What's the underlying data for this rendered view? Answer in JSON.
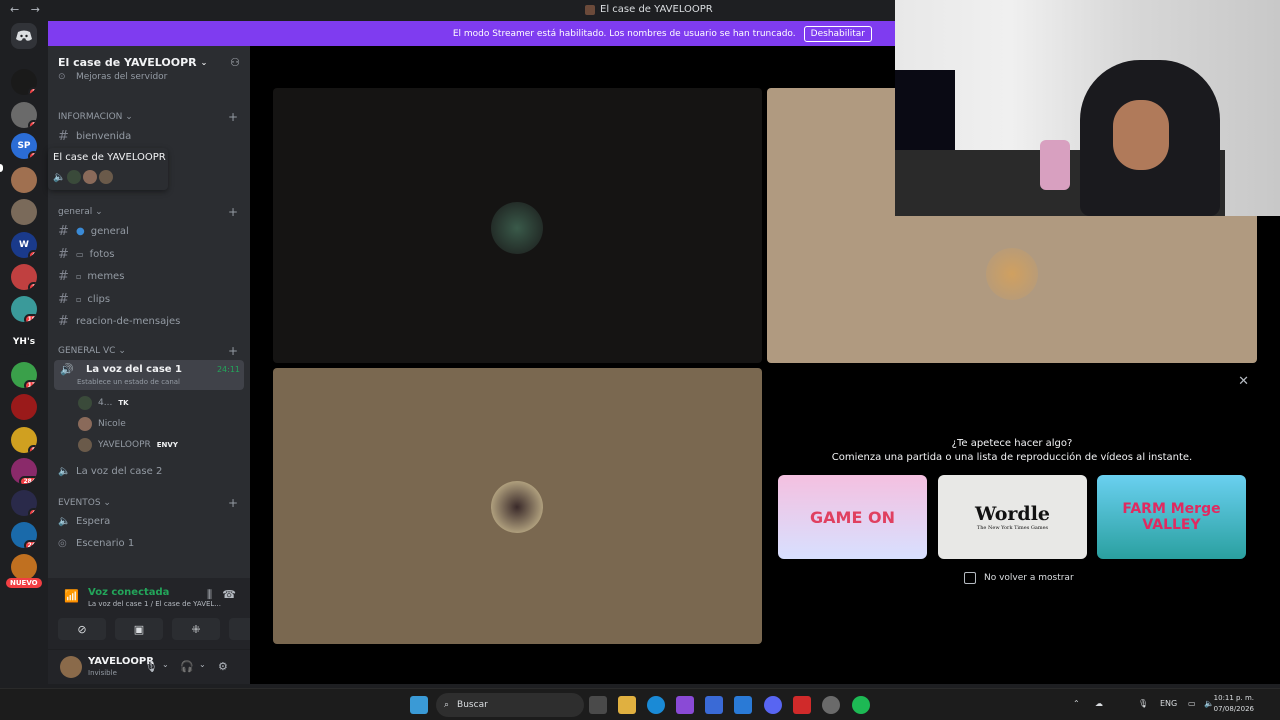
{
  "window": {
    "title": "El case de YAVELOOPR",
    "nav": "← →"
  },
  "banner": {
    "text": "El modo Streamer está habilitado. Los nombres de usuario se han truncado.",
    "button": "Deshabilitar"
  },
  "rail": {
    "servers": [
      {
        "label": "",
        "badge": "1",
        "color": "#1a1a1a"
      },
      {
        "label": "",
        "badge": "1",
        "color": "#6a6a6a"
      },
      {
        "label": "SP",
        "badge": "2",
        "color": "#2b6dd6"
      },
      {
        "label": "",
        "badge": "",
        "color": "#a07050"
      },
      {
        "label": "",
        "badge": "",
        "color": "#7a6a5a"
      },
      {
        "label": "W",
        "badge": "4",
        "color": "#1a3a8a"
      },
      {
        "label": "",
        "badge": "1",
        "color": "#c04040"
      },
      {
        "label": "",
        "badge": "19",
        "color": "#3a9a9a"
      },
      {
        "label": "YH's",
        "badge": "",
        "color": "#1e1f22"
      },
      {
        "label": "",
        "badge": "17",
        "color": "#3aa04a"
      },
      {
        "label": "",
        "badge": "",
        "color": "#9a1a1a"
      },
      {
        "label": "",
        "badge": "5",
        "color": "#d0a020"
      },
      {
        "label": "",
        "badge": "284",
        "color": "#8a2a6a"
      },
      {
        "label": "",
        "badge": "4",
        "color": "#2a2a4a"
      },
      {
        "label": "",
        "badge": "26",
        "color": "#1a6aaa"
      },
      {
        "label": "",
        "badge": "",
        "color": "#c07020"
      }
    ],
    "nuevo": "NUEVO"
  },
  "sidebar": {
    "server_name": "El case de YAVELOOPR",
    "boost_item": "Mejoras del servidor",
    "categories": {
      "informacion": "INFORMACION",
      "general": "general",
      "general_vc": "GENERAL VC",
      "eventos": "EVENTOS"
    },
    "info_channels": [
      "bienvenida"
    ],
    "text_channels": [
      "general",
      "fotos",
      "memes",
      "clips",
      "reacion-de-mensajes"
    ],
    "voice_active": {
      "name": "La voz del case 1",
      "time": "24:11",
      "status": "Establece un estado de canal"
    },
    "voice_users": [
      {
        "name": "4...",
        "tag": "TK"
      },
      {
        "name": "Nicole",
        "tag": ""
      },
      {
        "name": "YAVELOOPR",
        "tag": "ENVY"
      }
    ],
    "voice_other": "La voz del case 2",
    "event_channels": [
      "Espera",
      "Escenario 1"
    ],
    "tooltip": {
      "title": "El case de YAVELOOPR"
    },
    "voice_panel": {
      "status": "Voz conectada",
      "sub": "La voz del case 1 / El case de YAVEL..."
    },
    "user_panel": {
      "name": "YAVELOOPR",
      "status": "Invisible"
    }
  },
  "activity": {
    "question": "¿Te apetece hacer algo?",
    "subtitle": "Comienza una partida o una lista de reproducción de vídeos al instante.",
    "cards": [
      "GAME ON",
      "Wordle",
      "FARM Merge VALLEY"
    ],
    "wordle_sub": "The New York Times Games",
    "dont_show": "No volver a mostrar"
  },
  "taskbar": {
    "search": "Buscar",
    "lang": "ENG",
    "time": "10:11 p. m.",
    "date": "07/08/2026"
  },
  "colors": {
    "accent": "#7f3cf0",
    "green": "#23a55a",
    "red": "#f23f43",
    "tile_brown": "#b09a80",
    "tile_olive": "#7a6850"
  }
}
